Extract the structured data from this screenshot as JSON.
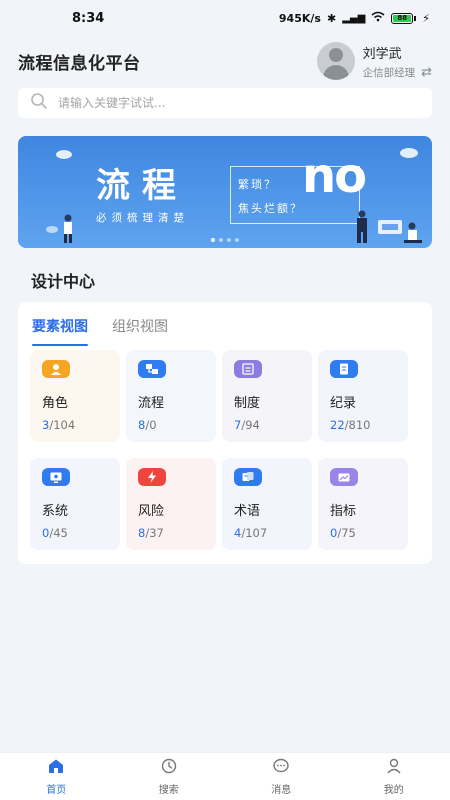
{
  "status_bar": {
    "time": "8:34",
    "network_speed": "945K/s",
    "battery": "88"
  },
  "header": {
    "app_title": "流程信息化平台",
    "user_name": "刘学武",
    "user_role": "企信部经理"
  },
  "search": {
    "placeholder": "请输入关键字试试..."
  },
  "banner": {
    "title": "流程",
    "subtitle": "必须梳理清楚",
    "line1": "繁琐？",
    "line2": "焦头烂额？",
    "logo_text": "no",
    "page_count": 4,
    "active_page": 1
  },
  "design_center": {
    "title": "设计中心",
    "tabs": [
      {
        "label": "要素视图",
        "active": true
      },
      {
        "label": "组织视图",
        "active": false
      }
    ],
    "cards": [
      {
        "label": "角色",
        "current": "3",
        "total": "/104",
        "icon": "user-icon",
        "color": "#f5a623",
        "bg": "#fdf8ef"
      },
      {
        "label": "流程",
        "current": "8",
        "total": "/0",
        "icon": "flow-icon",
        "color": "#2f7cf0",
        "bg": "#f3f6fb"
      },
      {
        "label": "制度",
        "current": "7",
        "total": "/94",
        "icon": "policy-icon",
        "color": "#8c7be0",
        "bg": "#f4f4f9"
      },
      {
        "label": "纪录",
        "current": "22",
        "total": "/810",
        "icon": "record-icon",
        "color": "#2f7cf0",
        "bg": "#f2f5fb"
      },
      {
        "label": "系统",
        "current": "0",
        "total": "/45",
        "icon": "system-icon",
        "color": "#2f7cf0",
        "bg": "#f2f5fb"
      },
      {
        "label": "风险",
        "current": "8",
        "total": "/37",
        "icon": "risk-icon",
        "color": "#f0453e",
        "bg": "#fcf2f2"
      },
      {
        "label": "术语",
        "current": "4",
        "total": "/107",
        "icon": "term-icon",
        "color": "#2f7cf0",
        "bg": "#f2f5fb"
      },
      {
        "label": "指标",
        "current": "0",
        "total": "/75",
        "icon": "indicator-icon",
        "color": "#9a84e6",
        "bg": "#f5f4fa"
      }
    ]
  },
  "bottom_nav": [
    {
      "label": "首页",
      "icon": "home-icon",
      "active": true
    },
    {
      "label": "搜索",
      "icon": "search-nav-icon",
      "active": false
    },
    {
      "label": "消息",
      "icon": "message-icon",
      "active": false
    },
    {
      "label": "我的",
      "icon": "profile-icon",
      "active": false
    }
  ],
  "colors": {
    "accent": "#2b6ee6",
    "background": "#f1f4f9"
  }
}
